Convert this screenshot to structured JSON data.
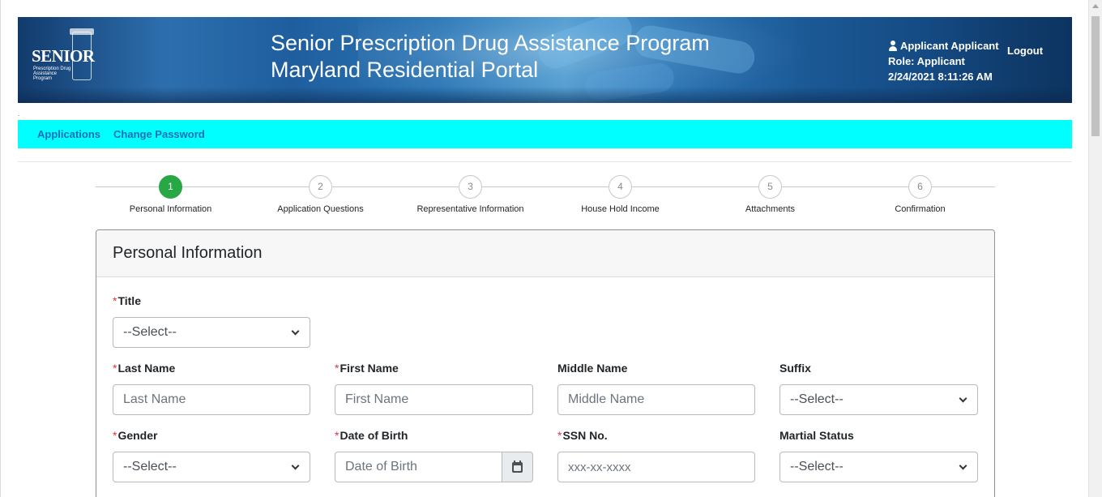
{
  "header": {
    "logo_word": "SENIOR",
    "logo_sub": "Prescription Drug Assistance Program",
    "title_line1": "Senior Prescription Drug Assistance Program",
    "title_line2": "Maryland Residential Portal",
    "user_name": "Applicant Applicant",
    "role": "Role: Applicant",
    "datetime": "2/24/2021 8:11:26 AM",
    "logout": "Logout",
    "stray_mark": "."
  },
  "nav": {
    "items": [
      "Applications",
      "Change Password"
    ]
  },
  "steps": [
    {
      "number": "1",
      "label": "Personal Information",
      "active": true
    },
    {
      "number": "2",
      "label": "Application Questions",
      "active": false
    },
    {
      "number": "3",
      "label": "Representative Information",
      "active": false
    },
    {
      "number": "4",
      "label": "House Hold Income",
      "active": false
    },
    {
      "number": "5",
      "label": "Attachments",
      "active": false
    },
    {
      "number": "6",
      "label": "Confirmation",
      "active": false
    }
  ],
  "form": {
    "heading": "Personal Information",
    "required_mark": "*",
    "fields": {
      "title": {
        "label": "Title",
        "value": "--Select--"
      },
      "last_name": {
        "label": "Last Name",
        "placeholder": "Last Name"
      },
      "first_name": {
        "label": "First Name",
        "placeholder": "First Name"
      },
      "middle_name": {
        "label": "Middle Name",
        "placeholder": "Middle Name"
      },
      "suffix": {
        "label": "Suffix",
        "value": "--Select--"
      },
      "gender": {
        "label": "Gender",
        "value": "--Select--"
      },
      "dob": {
        "label": "Date of Birth",
        "placeholder": "Date of Birth"
      },
      "ssn": {
        "label": "SSN No.",
        "placeholder": "xxx-xx-xxxx"
      },
      "marital": {
        "label": "Martial Status",
        "value": "--Select--"
      }
    }
  },
  "colors": {
    "nav_bg": "#00ffff",
    "nav_link": "#1a6fb5",
    "step_active": "#28a745",
    "required": "#dc3545"
  }
}
